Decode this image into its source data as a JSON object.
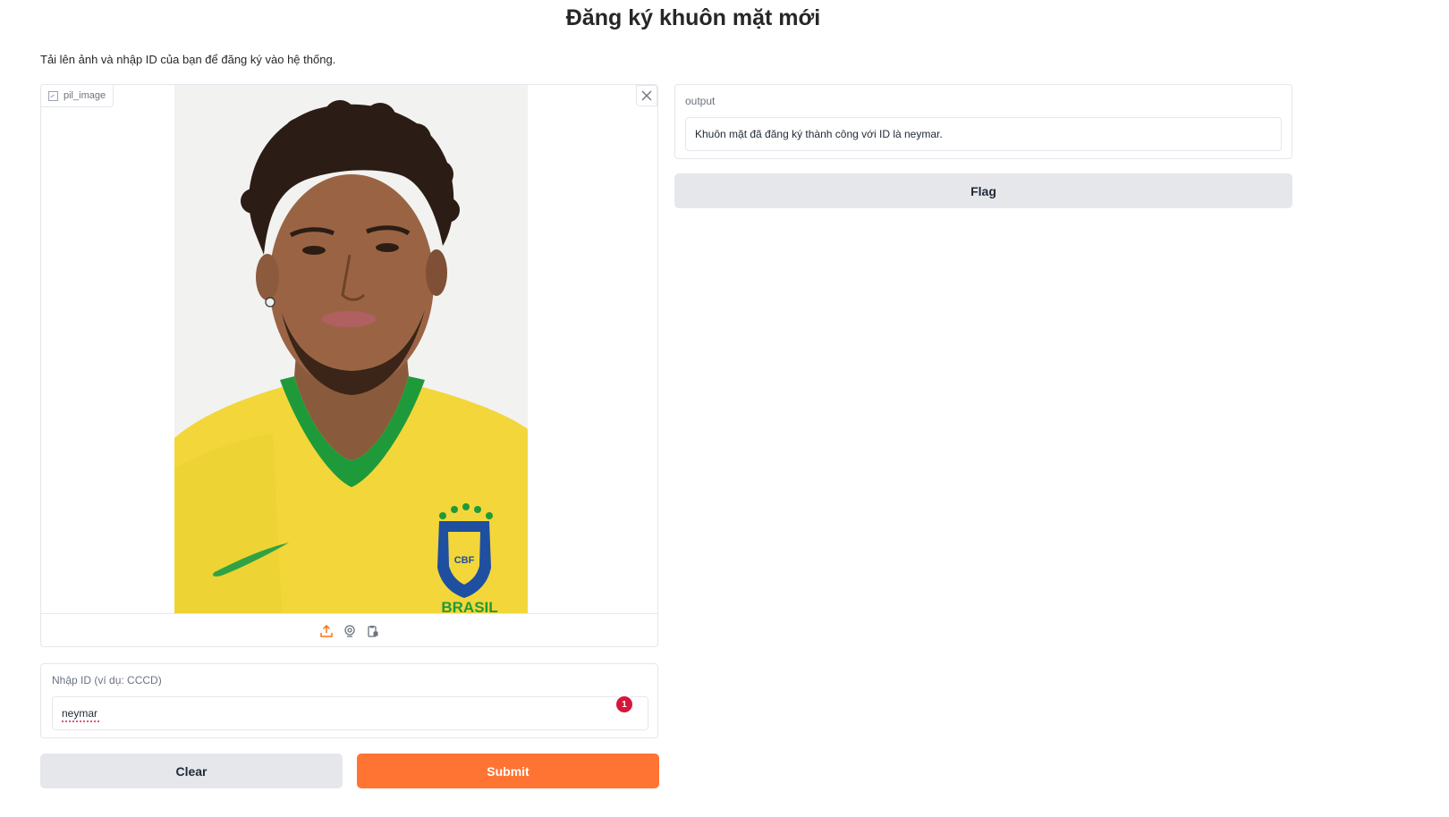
{
  "header": {
    "title": "Đăng ký khuôn mặt mới",
    "description": "Tải lên ảnh và nhập ID của bạn để đăng ký vào hệ thống."
  },
  "image_input": {
    "label": "pil_image",
    "tools": [
      "upload-icon",
      "webcam-icon",
      "clipboard-icon"
    ],
    "photo_text": "BRASIL",
    "badge_text": "CBF"
  },
  "id_input": {
    "label": "Nhập ID (ví dụ: CCCD)",
    "value": "neymar",
    "spell_badge": "1"
  },
  "buttons": {
    "clear": "Clear",
    "submit": "Submit",
    "flag": "Flag"
  },
  "output": {
    "label": "output",
    "value": "Khuôn mặt đã đăng ký thành công với ID là neymar."
  },
  "colors": {
    "accent": "#ff7433",
    "secondary_button": "#e5e7eb",
    "border": "#e5e7eb"
  }
}
